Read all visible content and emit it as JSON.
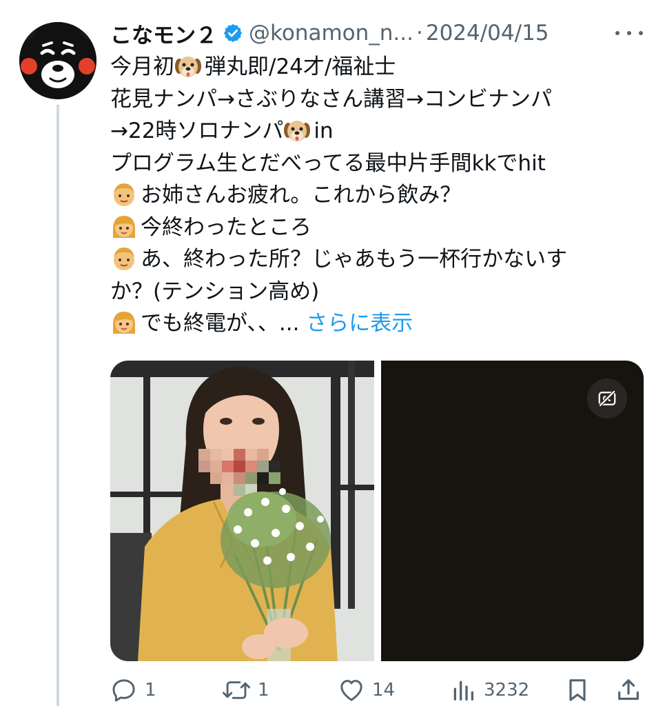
{
  "tweet": {
    "author": {
      "name": "こなモン２",
      "handle": "@konamon_n...",
      "verified": true
    },
    "date": "2024/04/15",
    "body": {
      "line1": {
        "pre": "今月初",
        "post": "弾丸即/24才/福祉士"
      },
      "line2": "花見ナンパ→さぶりなさん講習→コンビナンパ",
      "line3": {
        "pre": "→22時ソロナンパ",
        "post": "in"
      },
      "line4": "プログラム生とだべってる最中片手間kkでhit",
      "line5": "お姉さんお疲れ。これから飲み？",
      "line6": "今終わったところ",
      "line7": "あ、終わった所？じゃあもう一杯行かないす",
      "line8": "か？(テンション高め)",
      "line9": "でも終電が、、... ",
      "show_more": "さらに表示"
    },
    "media": {
      "count": 2,
      "caption_button_icon": "cc-off-icon"
    },
    "actions": {
      "replies": "1",
      "reposts": "1",
      "likes": "14",
      "views": "3232"
    }
  },
  "colors": {
    "accent": "#1d9bf0",
    "secondary_text": "#536471",
    "text": "#0f1419"
  }
}
